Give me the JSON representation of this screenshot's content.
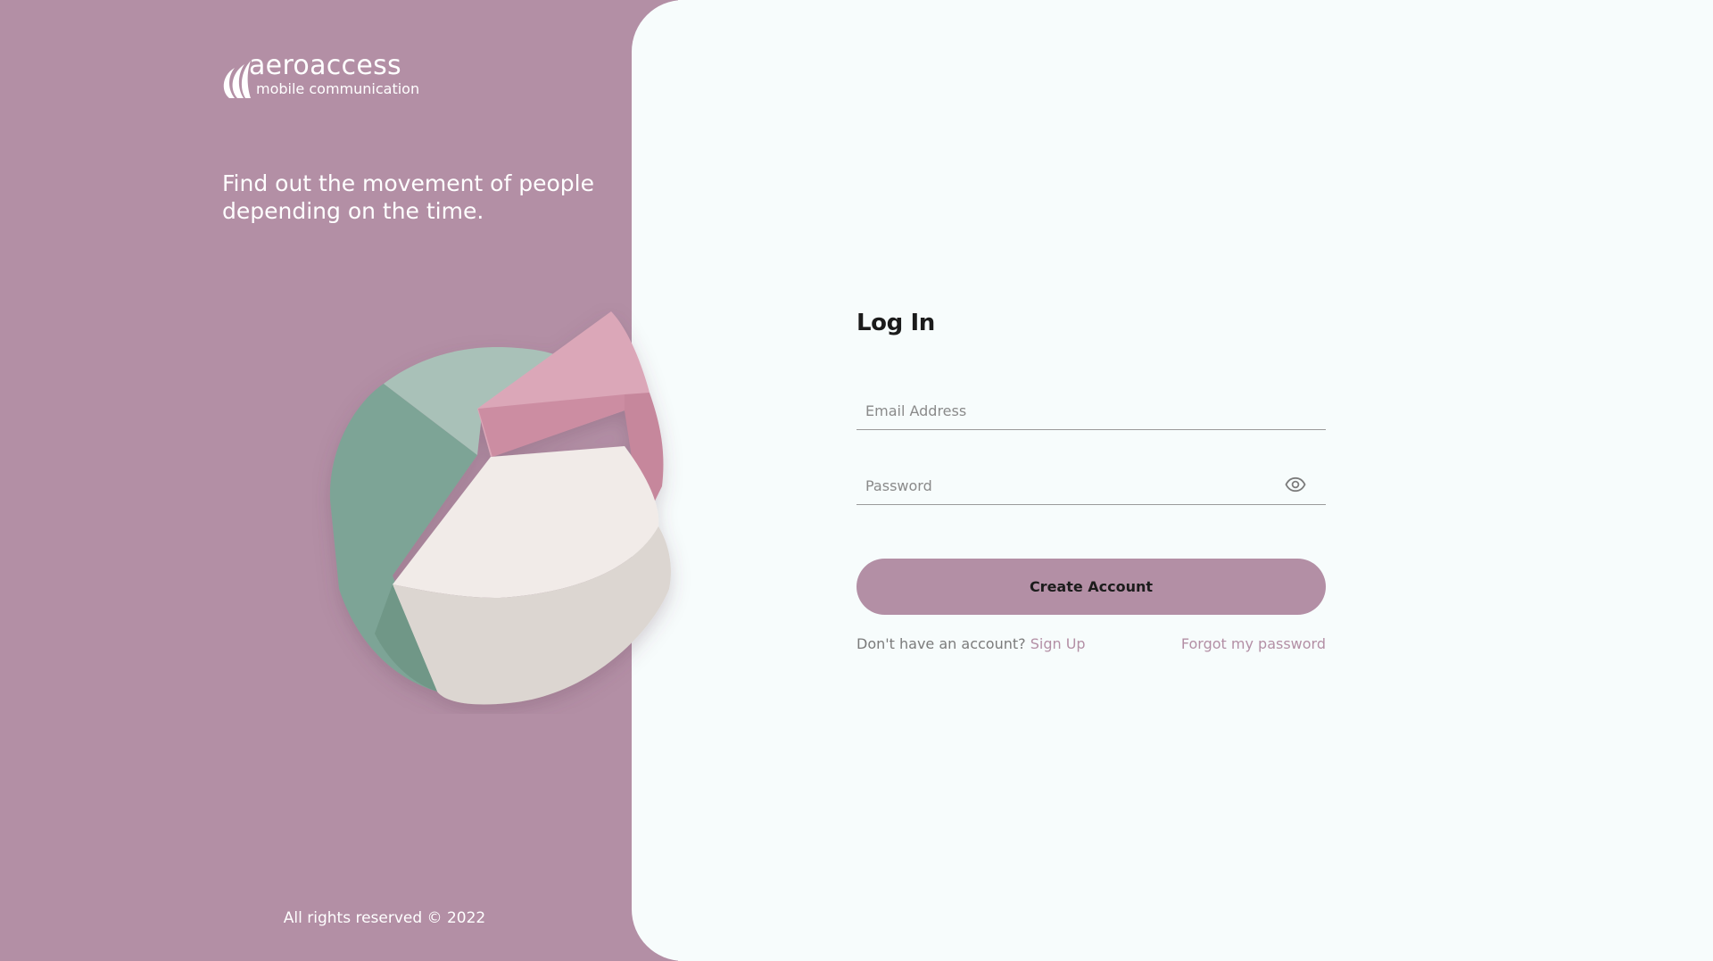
{
  "brand": {
    "name": "aeroaccess",
    "subtitle": "mobile communication",
    "tagline": "Find out the movement of people depending on the time.",
    "copyright": "All rights reserved © 2022"
  },
  "login": {
    "title": "Log In",
    "email_placeholder": "Email Address",
    "password_placeholder": "Password",
    "submit_label": "Create Account",
    "signup_prompt": "Don't have an account?",
    "signup_link": "Sign Up",
    "forgot_link": "Forgot my password"
  },
  "icons": {
    "logo": "swoosh-logo-icon",
    "illustration": "pie-chart-3d-illustration",
    "password_toggle": "eye-icon"
  },
  "colors": {
    "brand_panel": "#b38fa5",
    "card_background": "#f7fcfc",
    "button": "#b38fa5",
    "link": "#b38fa5",
    "pie_green_light": "#a9c1b8",
    "pie_green_dark": "#7da496",
    "pie_pink": "#dba7b8",
    "pie_white": "#efe8e4"
  }
}
